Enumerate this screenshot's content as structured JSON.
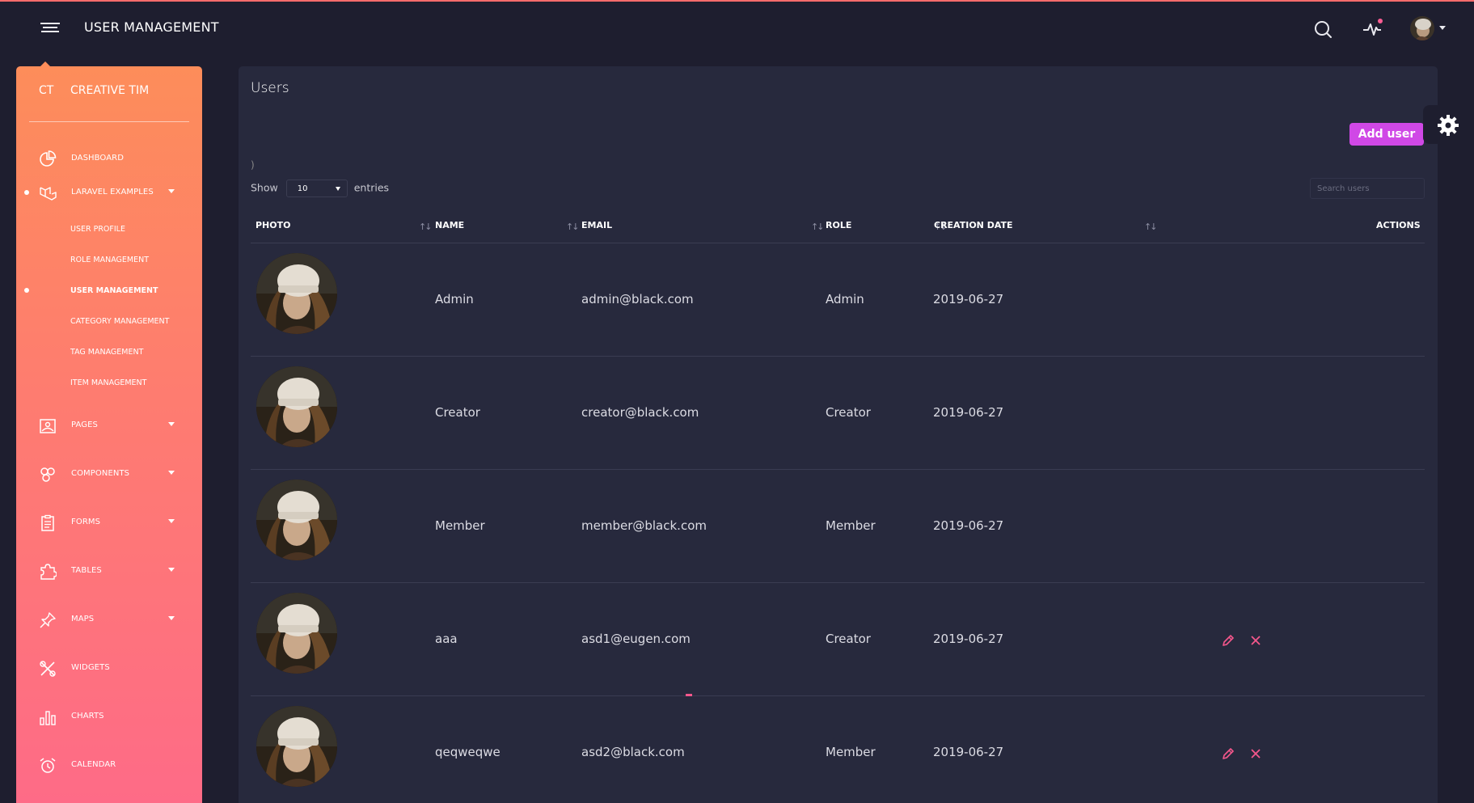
{
  "header": {
    "title": "USER MANAGEMENT",
    "icons": [
      "menu-icon",
      "search-icon",
      "activity-icon",
      "avatar"
    ]
  },
  "sidebar": {
    "logo_short": "CT",
    "logo_name": "CREATIVE TIM",
    "items": [
      {
        "label": "DASHBOARD",
        "icon": "pie-chart-icon"
      },
      {
        "label": "LARAVEL EXAMPLES",
        "icon": "laravel-icon",
        "expanded": true
      },
      {
        "label": "PAGES",
        "icon": "image-icon"
      },
      {
        "label": "COMPONENTS",
        "icon": "components-icon"
      },
      {
        "label": "FORMS",
        "icon": "clipboard-icon"
      },
      {
        "label": "TABLES",
        "icon": "puzzle-icon"
      },
      {
        "label": "MAPS",
        "icon": "pin-icon"
      },
      {
        "label": "WIDGETS",
        "icon": "settings-tools-icon"
      },
      {
        "label": "CHARTS",
        "icon": "bar-chart-icon"
      },
      {
        "label": "CALENDAR",
        "icon": "alarm-clock-icon"
      }
    ],
    "subitems": [
      {
        "label": "USER PROFILE"
      },
      {
        "label": "ROLE MANAGEMENT"
      },
      {
        "label": "USER MANAGEMENT",
        "active": true
      },
      {
        "label": "CATEGORY MANAGEMENT"
      },
      {
        "label": "TAG MANAGEMENT"
      },
      {
        "label": "ITEM MANAGEMENT"
      }
    ]
  },
  "main": {
    "card_title": "Users",
    "add_button": "Add user",
    "stray": ")",
    "show_label": "Show",
    "entries_value": "10",
    "entries_label": "entries",
    "search_placeholder": "Search users",
    "columns": [
      "PHOTO",
      "NAME",
      "EMAIL",
      "ROLE",
      "CREATION DATE",
      "ACTIONS"
    ],
    "rows": [
      {
        "name": "Admin",
        "email": "admin@black.com",
        "role": "Admin",
        "date": "2019-06-27",
        "actions": false
      },
      {
        "name": "Creator",
        "email": "creator@black.com",
        "role": "Creator",
        "date": "2019-06-27",
        "actions": false
      },
      {
        "name": "Member",
        "email": "member@black.com",
        "role": "Member",
        "date": "2019-06-27",
        "actions": false
      },
      {
        "name": "aaa",
        "email": "asd1@eugen.com",
        "role": "Creator",
        "date": "2019-06-27",
        "actions": true
      },
      {
        "name": "qeqweqwe",
        "email": "asd2@black.com",
        "role": "Member",
        "date": "2019-06-27",
        "actions": true
      }
    ]
  },
  "colors": {
    "background": "#1e1e2f",
    "card": "#27293d",
    "sidebar_top": "#fd8d5a",
    "sidebar_bottom": "#fe6b87",
    "accent_button": "#d048e6",
    "action_icon": "#f5578c",
    "notification_dot": "#fd5d93"
  }
}
